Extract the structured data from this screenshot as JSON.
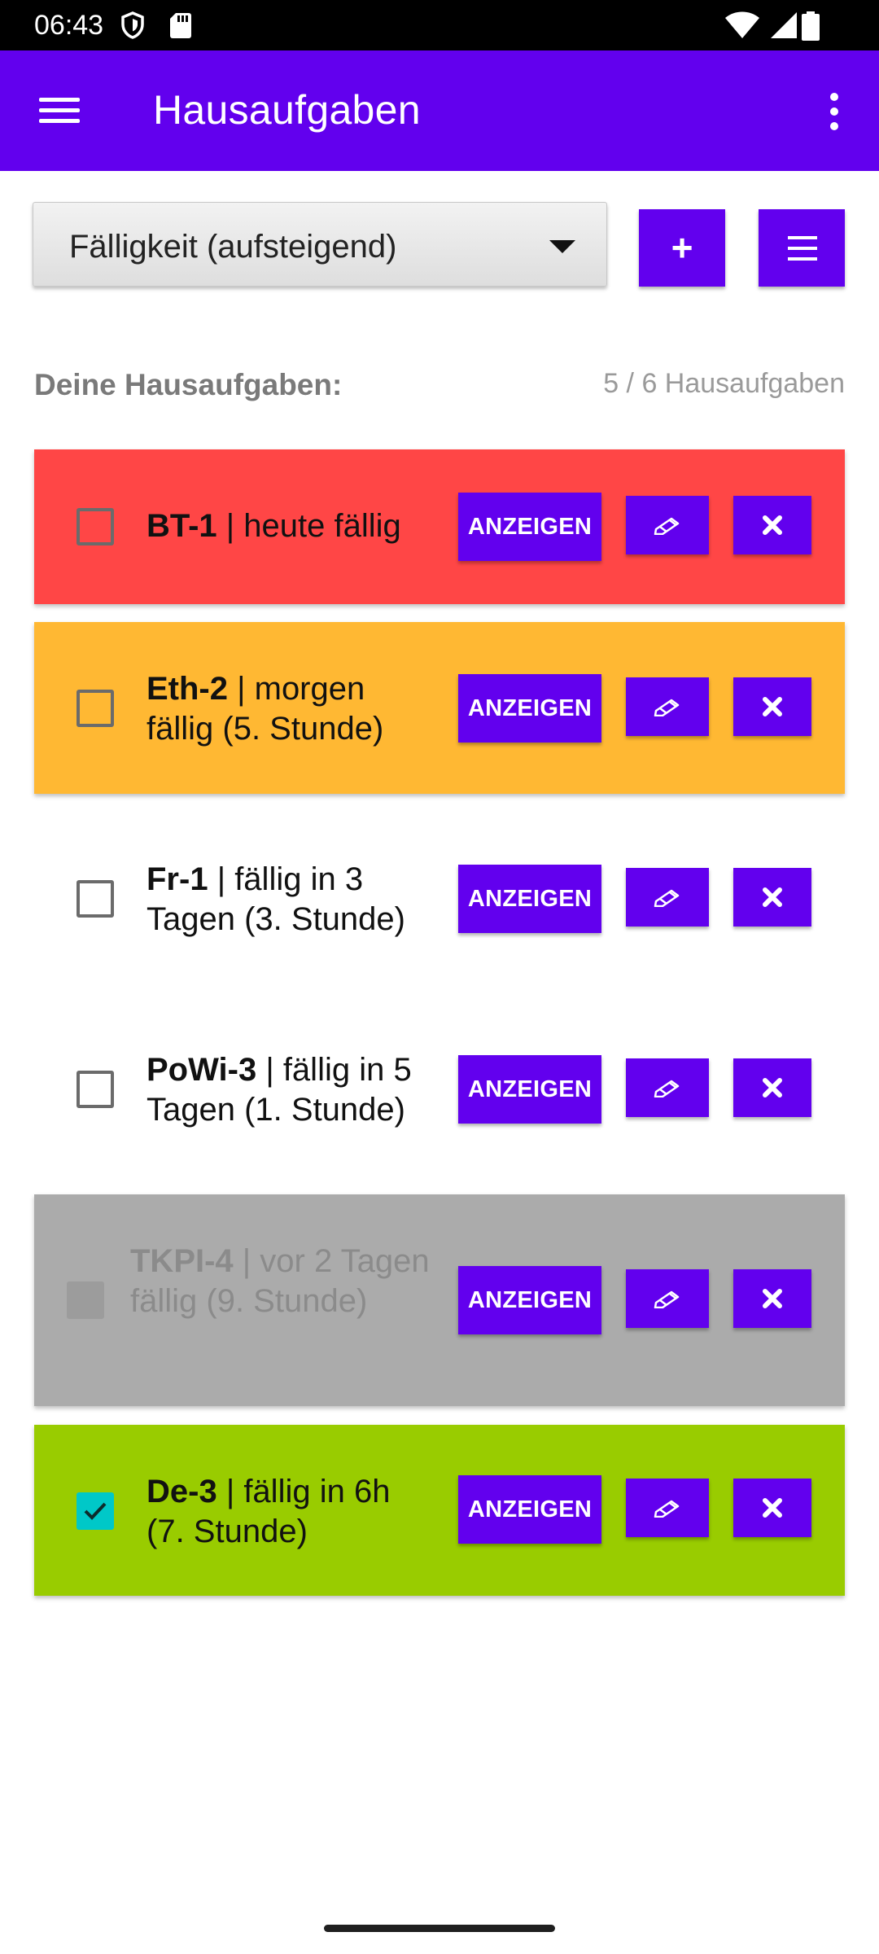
{
  "status_bar": {
    "time": "06:43"
  },
  "app_bar": {
    "title": "Hausaufgaben"
  },
  "sort": {
    "selected": "Fälligkeit (aufsteigend)"
  },
  "toolbar": {
    "add_label": "+"
  },
  "list_header": {
    "title": "Deine Hausaufgaben:",
    "count": "5 / 6 Hausaufgaben"
  },
  "homework": [
    {
      "subject": "BT-1",
      "detail": " | heute fällig",
      "color": "#FF4646",
      "checked": false,
      "done": false
    },
    {
      "subject": "Eth-2",
      "detail": " | morgen fällig (5. Stunde)",
      "color": "#FFB833",
      "checked": false,
      "done": false
    },
    {
      "subject": "Fr-1",
      "detail": " | fällig in 3 Tagen (3. Stunde)",
      "color": "#FFFFFF",
      "checked": false,
      "done": false
    },
    {
      "subject": "PoWi-3",
      "detail": " | fällig in 5 Tagen (1. Stunde)",
      "color": "#FFFFFF",
      "checked": false,
      "done": false
    },
    {
      "subject": "TKPI-4",
      "detail": " | vor 2 Tagen fällig (9. Stunde)",
      "color": "#ABABAB",
      "checked": false,
      "done": true
    },
    {
      "subject": "De-3",
      "detail": " | fällig in 6h (7. Stunde)",
      "color": "#99CC00",
      "checked": true,
      "done": false
    }
  ],
  "actions": {
    "show_label": "ANZEIGEN"
  },
  "colors": {
    "accent": "#6200EE",
    "checkbox_checked": "#00C8C8"
  }
}
